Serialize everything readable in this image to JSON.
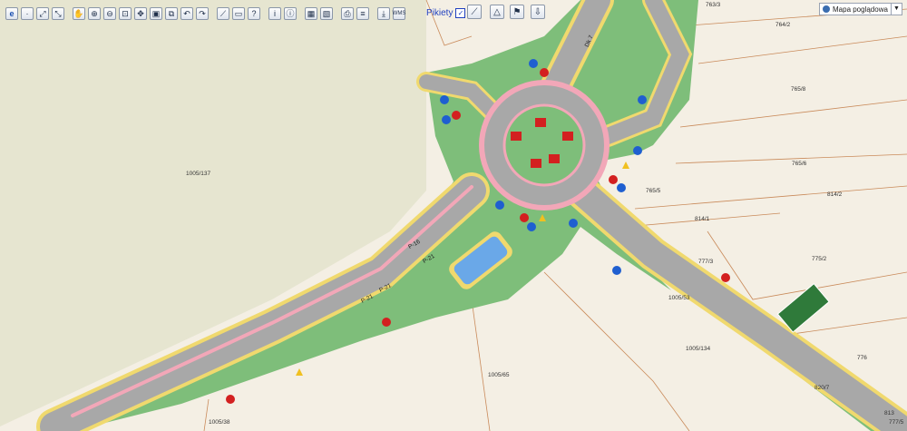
{
  "toolbar": {
    "buttons": [
      {
        "name": "edge-logo-button",
        "glyph": "e"
      },
      {
        "name": "dot-button",
        "glyph": "·"
      },
      {
        "name": "zoom-extent-button",
        "glyph": "⤢"
      },
      {
        "name": "zoom-fit-button",
        "glyph": "⤡"
      },
      {
        "name": "pan-hand-button",
        "glyph": "✋"
      },
      {
        "name": "zoom-in-button",
        "glyph": "⊕"
      },
      {
        "name": "zoom-out-button",
        "glyph": "⊖"
      },
      {
        "name": "zoom-window-button",
        "glyph": "⊡"
      },
      {
        "name": "move-map-button",
        "glyph": "✥"
      },
      {
        "name": "zoom-full-button",
        "glyph": "▣"
      },
      {
        "name": "layers-button",
        "glyph": "⧉"
      },
      {
        "name": "back-button",
        "glyph": "↶"
      },
      {
        "name": "forward-button",
        "glyph": "↷"
      },
      {
        "name": "measure-line-button",
        "glyph": "⟋"
      },
      {
        "name": "measure-area-button",
        "glyph": "▭"
      },
      {
        "name": "identify-button",
        "glyph": "?"
      },
      {
        "name": "info-button",
        "glyph": "i"
      },
      {
        "name": "info-pointer-button",
        "glyph": "ⓘ"
      },
      {
        "name": "select-button",
        "glyph": "▦"
      },
      {
        "name": "select-area-button",
        "glyph": "▧"
      },
      {
        "name": "print-button",
        "glyph": "⎙"
      },
      {
        "name": "database-button",
        "glyph": "≡"
      },
      {
        "name": "download-button",
        "glyph": "⤓"
      },
      {
        "name": "wms-button",
        "glyph": "WMS"
      }
    ],
    "pikiety_label": "Pikiety",
    "pikiety_check": "✓",
    "right_tools": [
      "⟋",
      "△",
      "⚑",
      "⇩"
    ]
  },
  "basemap": {
    "label": "Mapa poglądowa",
    "arrow": "▼"
  },
  "parcels": [
    {
      "label": "763/3"
    },
    {
      "label": "764/2"
    },
    {
      "label": "765/8"
    },
    {
      "label": "765/6"
    },
    {
      "label": "765/5"
    },
    {
      "label": "814/2"
    },
    {
      "label": "814/1"
    },
    {
      "label": "775/2"
    },
    {
      "label": "1005/137"
    },
    {
      "label": "1005/65"
    },
    {
      "label": "1005/134"
    },
    {
      "label": "776"
    },
    {
      "label": "1005/38"
    },
    {
      "label": "777/3"
    },
    {
      "label": "1005/53"
    },
    {
      "label": "820/7"
    },
    {
      "label": "777/5"
    },
    {
      "label": "813"
    }
  ],
  "road_labels": [
    "P-21",
    "P-21",
    "P-16",
    "Dk 7",
    "P-21"
  ],
  "colors": {
    "land": "#f4efe4",
    "field": "#e6e5d0",
    "grass": "#7ebe7a",
    "road": "#a8a8a8",
    "shoulder": "#f0d96e",
    "bike": "#f2a7b8",
    "water": "#6aa8e8",
    "parcel_line": "#c98a5a"
  }
}
